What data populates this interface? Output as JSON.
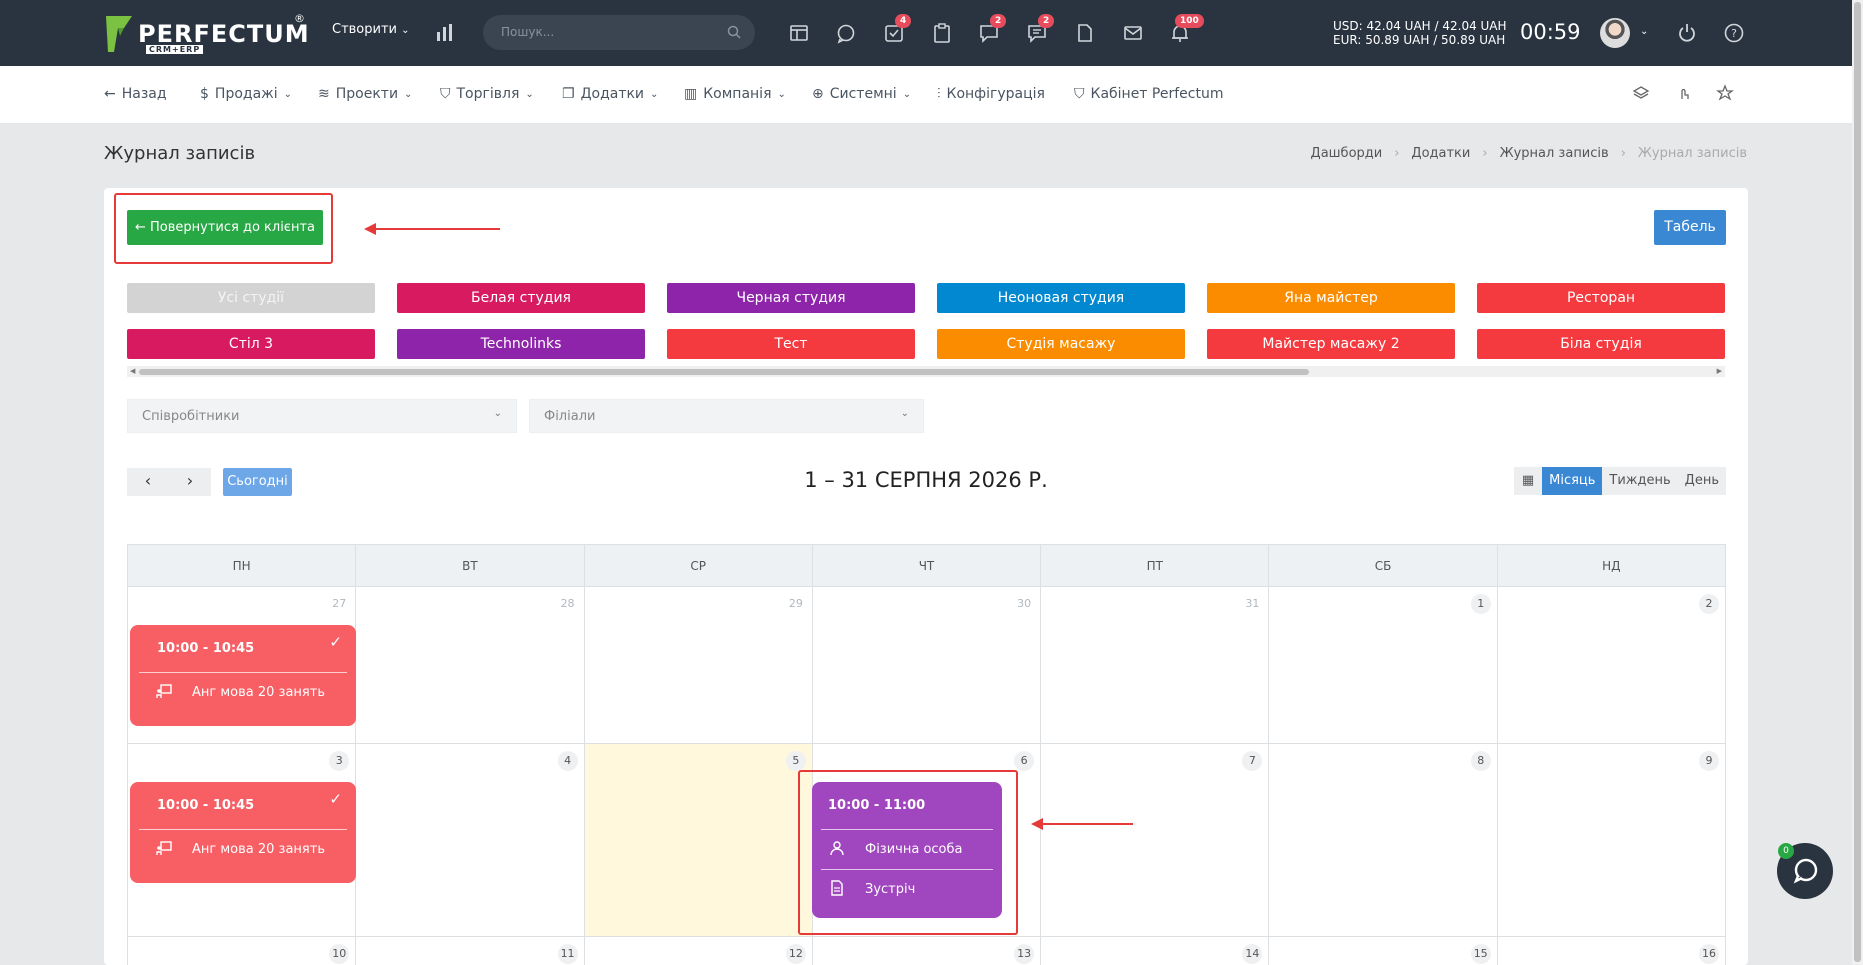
{
  "topbar": {
    "logo_text": "PERFECTUM",
    "logo_sub": "CRM+ERP",
    "logo_reg": "®",
    "create_label": "Створити",
    "search_placeholder": "Пошук...",
    "badges": {
      "tasks": "4",
      "chat": "2",
      "messages": "2",
      "notifications": "100"
    },
    "rate_usd": "USD: 42.04 UAH / 42.04 UAH",
    "rate_eur": "EUR: 50.89 UAH / 50.89 UAH",
    "clock": "00:59"
  },
  "nav": {
    "back": "Назад",
    "items": [
      "Продажі",
      "Проекти",
      "Торгівля",
      "Додатки",
      "Компанія",
      "Системні",
      "Конфігурація",
      "Кабінет Perfectum"
    ]
  },
  "page": {
    "title": "Журнал записів",
    "breadcrumb": [
      "Дашборди",
      "Додатки",
      "Журнал записів",
      "Журнал записів"
    ]
  },
  "actions": {
    "back_to_client": "← Повернутися до клієнта",
    "tabel": "Табель"
  },
  "studios": [
    {
      "label": "Усі студії",
      "color": "#d3d3d3"
    },
    {
      "label": "Белая студия",
      "color": "#d81b60"
    },
    {
      "label": "Черная студия",
      "color": "#8e24aa"
    },
    {
      "label": "Неоновая студия",
      "color": "#0288d1"
    },
    {
      "label": "Яна майстер",
      "color": "#fb8c00"
    },
    {
      "label": "Ресторан",
      "color": "#f4393f"
    },
    {
      "label": "Стіл 3",
      "color": "#d81b60"
    },
    {
      "label": "Technolinks",
      "color": "#8e24aa"
    },
    {
      "label": "Тест",
      "color": "#f4393f"
    },
    {
      "label": "Студія масажу",
      "color": "#fb8c00"
    },
    {
      "label": "Майстер масажу 2",
      "color": "#f4393f"
    },
    {
      "label": "Біла студія",
      "color": "#f4393f"
    }
  ],
  "filters": {
    "employees": "Співробітники",
    "branches": "Філіали"
  },
  "calendar": {
    "prev": "‹",
    "next": "›",
    "today": "Сьогодні",
    "title": "1 – 31 СЕРПНЯ 2026 Р.",
    "views": [
      "Місяць",
      "Тиждень",
      "День"
    ],
    "weekdays": [
      "ПН",
      "ВТ",
      "СР",
      "ЧТ",
      "ПТ",
      "СБ",
      "НД"
    ],
    "weeks": [
      [
        "27",
        "28",
        "29",
        "30",
        "31",
        "1",
        "2"
      ],
      [
        "3",
        "4",
        "5",
        "6",
        "7",
        "8",
        "9"
      ],
      [
        "10",
        "11",
        "12",
        "13",
        "14",
        "15",
        "16"
      ]
    ],
    "events": [
      {
        "time": "10:00 - 10:45",
        "title": "Анг мова 20 занять",
        "check": "✓",
        "color": "#f75f64"
      },
      {
        "time": "10:00 - 10:45",
        "title": "Анг мова 20 занять",
        "check": "✓",
        "color": "#f75f64"
      },
      {
        "time": "10:00 - 11:00",
        "client": "Фізична особа",
        "title": "Зустріч",
        "color": "#a046bf"
      }
    ]
  },
  "chat_badge": "0"
}
